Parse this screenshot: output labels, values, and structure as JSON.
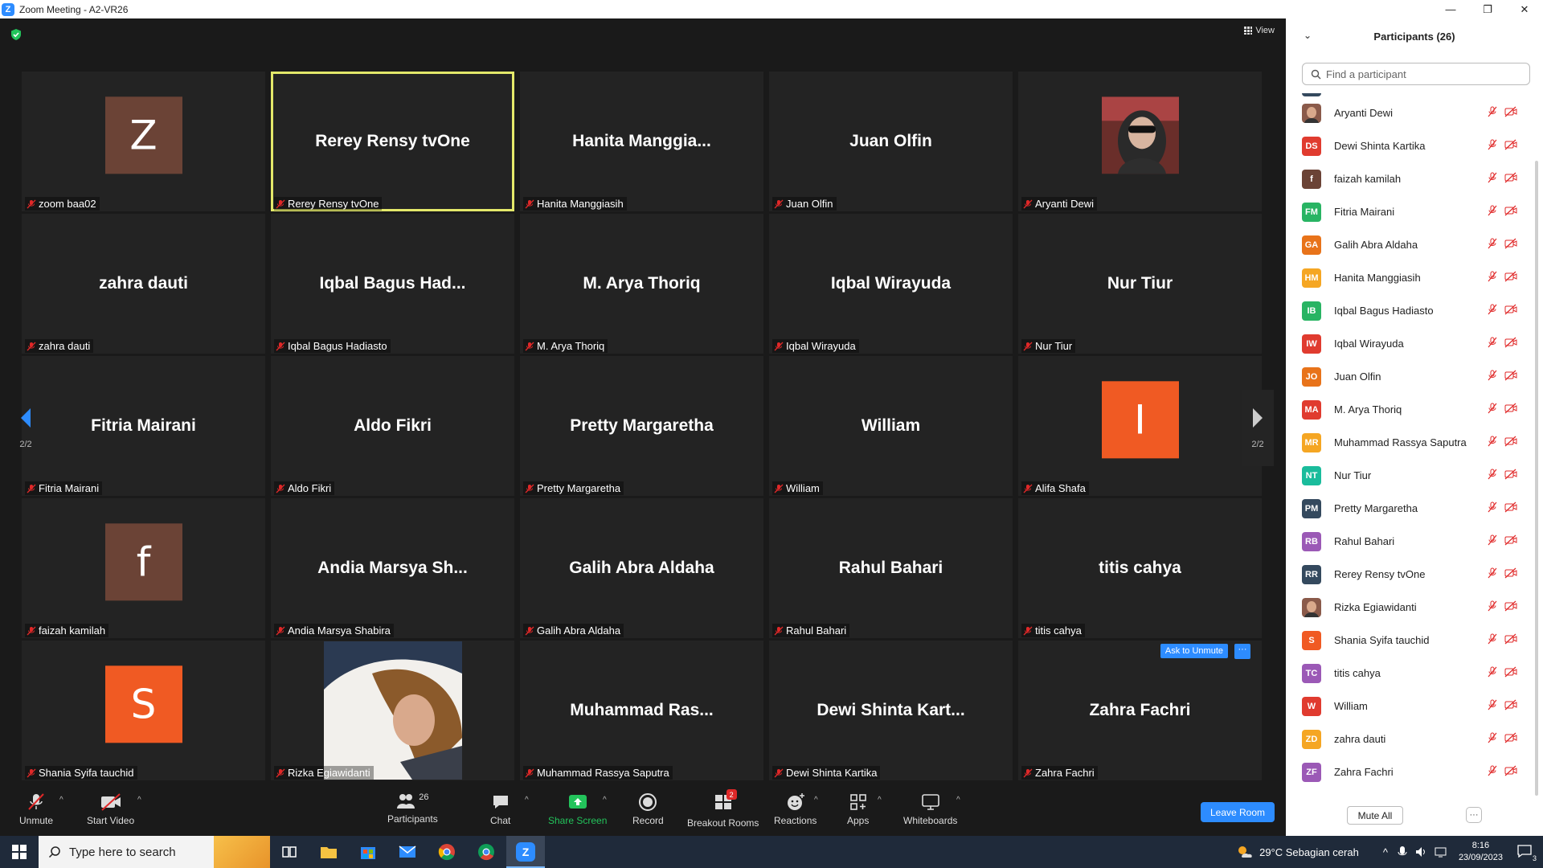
{
  "window": {
    "title": "Zoom Meeting - A2-VR26"
  },
  "meeting": {
    "view_label": "View",
    "page_indicator": "2/2",
    "tiles": [
      {
        "big": "",
        "label": "zoom baa02",
        "avatar": {
          "type": "letter",
          "letter": "Z",
          "color": "#6b4336"
        }
      },
      {
        "big": "Rerey Rensy tvOne",
        "label": "Rerey Rensy tvOne",
        "active": true
      },
      {
        "big": "Hanita  Manggia...",
        "label": "Hanita Manggiasih"
      },
      {
        "big": "Juan Olfin",
        "label": "Juan Olfin"
      },
      {
        "big": "",
        "label": "Aryanti Dewi",
        "avatar": {
          "type": "photo"
        }
      },
      {
        "big": "zahra dauti",
        "label": "zahra dauti"
      },
      {
        "big": "Iqbal Bagus Had...",
        "label": "Iqbal Bagus Hadiasto"
      },
      {
        "big": "M. Arya Thoriq",
        "label": "M. Arya Thoriq"
      },
      {
        "big": "Iqbal Wirayuda",
        "label": "Iqbal Wirayuda"
      },
      {
        "big": "Nur Tiur",
        "label": "Nur Tiur"
      },
      {
        "big": "Fitria Mairani",
        "label": "Fitria Mairani"
      },
      {
        "big": "Aldo Fikri",
        "label": "Aldo Fikri"
      },
      {
        "big": "Pretty Margaretha",
        "label": "Pretty Margaretha"
      },
      {
        "big": "William",
        "label": "William"
      },
      {
        "big": "",
        "label": "Alifa Shafa",
        "avatar": {
          "type": "letter",
          "letter": "I",
          "color": "#f05a23"
        }
      },
      {
        "big": "",
        "label": "faizah kamilah",
        "avatar": {
          "type": "letter",
          "letter": "f",
          "color": "#6b4336"
        }
      },
      {
        "big": "Andia Marsya Sh...",
        "label": "Andia Marsya Shabira"
      },
      {
        "big": "Galih Abra Aldaha",
        "label": "Galih Abra Aldaha"
      },
      {
        "big": "Rahul Bahari",
        "label": "Rahul Bahari"
      },
      {
        "big": "titis cahya",
        "label": "titis cahya"
      },
      {
        "big": "",
        "label": "Shania Syifa tauchid",
        "avatar": {
          "type": "letter",
          "letter": "S",
          "color": "#f05a23"
        }
      },
      {
        "big": "",
        "label": "Rizka Egiawidanti",
        "avatar": {
          "type": "photo2"
        }
      },
      {
        "big": "Muhammad  Ras...",
        "label": "Muhammad Rassya Saputra"
      },
      {
        "big": "Dewi Shinta Kart...",
        "label": "Dewi Shinta Kartika"
      },
      {
        "big": "Zahra Fachri",
        "label": "Zahra Fachri",
        "ask": "Ask to Unmute",
        "more": "···"
      }
    ]
  },
  "toolbar": {
    "unmute": "Unmute",
    "start_video": "Start Video",
    "participants": "Participants",
    "participants_count": "26",
    "chat": "Chat",
    "share_screen": "Share Screen",
    "record": "Record",
    "breakout": "Breakout Rooms",
    "breakout_badge": "2",
    "reactions": "Reactions",
    "apps": "Apps",
    "whiteboards": "Whiteboards",
    "leave": "Leave Room"
  },
  "panel": {
    "title": "Participants (26)",
    "search_placeholder": "Find a participant",
    "mute_all": "Mute All",
    "more": "···",
    "participants": [
      {
        "initials": "",
        "name": "Aryanti Dewi",
        "color": "#8a5a4a",
        "photo": true
      },
      {
        "initials": "DS",
        "name": "Dewi Shinta Kartika",
        "color": "#e03b2f"
      },
      {
        "initials": "f",
        "name": "faizah kamilah",
        "color": "#6b4336"
      },
      {
        "initials": "FM",
        "name": "Fitria Mairani",
        "color": "#28b463"
      },
      {
        "initials": "GA",
        "name": "Galih Abra Aldaha",
        "color": "#e8731a"
      },
      {
        "initials": "HM",
        "name": "Hanita Manggiasih",
        "color": "#f5a623"
      },
      {
        "initials": "IB",
        "name": "Iqbal Bagus Hadiasto",
        "color": "#28b463"
      },
      {
        "initials": "IW",
        "name": "Iqbal Wirayuda",
        "color": "#e03b2f"
      },
      {
        "initials": "JO",
        "name": "Juan Olfin",
        "color": "#e8731a"
      },
      {
        "initials": "MA",
        "name": "M. Arya Thoriq",
        "color": "#e03b2f"
      },
      {
        "initials": "MR",
        "name": "Muhammad Rassya Saputra",
        "color": "#f5a623"
      },
      {
        "initials": "NT",
        "name": "Nur Tiur",
        "color": "#1abc9c"
      },
      {
        "initials": "PM",
        "name": "Pretty Margaretha",
        "color": "#34495e"
      },
      {
        "initials": "RB",
        "name": "Rahul Bahari",
        "color": "#9b59b6"
      },
      {
        "initials": "RR",
        "name": "Rerey Rensy tvOne",
        "color": "#34495e"
      },
      {
        "initials": "",
        "name": "Rizka Egiawidanti",
        "color": "#8a5a4a",
        "photo": true
      },
      {
        "initials": "S",
        "name": "Shania Syifa tauchid",
        "color": "#f05a23"
      },
      {
        "initials": "TC",
        "name": "titis cahya",
        "color": "#9b59b6"
      },
      {
        "initials": "W",
        "name": "William",
        "color": "#e03b2f"
      },
      {
        "initials": "ZD",
        "name": "zahra dauti",
        "color": "#f5a623"
      },
      {
        "initials": "ZF",
        "name": "Zahra Fachri",
        "color": "#9b59b6"
      }
    ]
  },
  "taskbar": {
    "search_placeholder": "Type here to search",
    "weather": "29°C  Sebagian cerah",
    "time": "8:16",
    "date": "23/09/2023",
    "notif_count": "3"
  }
}
